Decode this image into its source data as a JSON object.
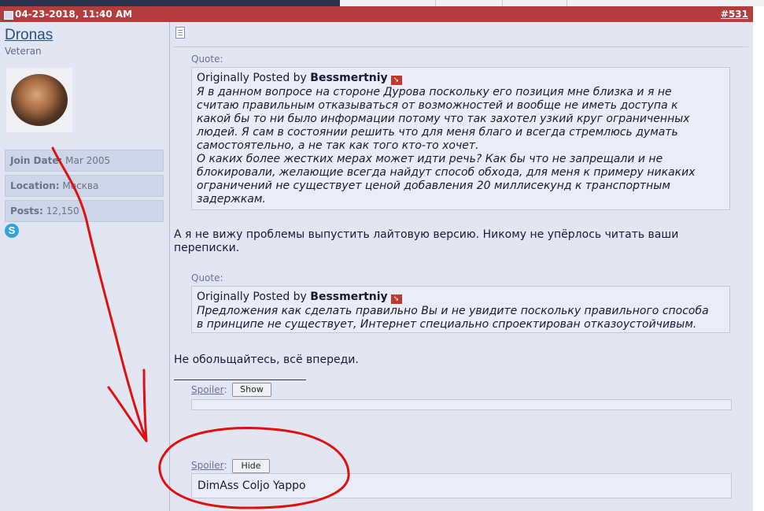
{
  "post": {
    "date": "04-23-2018, 11:40 AM",
    "number": "#531"
  },
  "user": {
    "name": "Dronas",
    "title": "Veteran",
    "join_label": "Join Date:",
    "join_value": "Mar 2005",
    "location_label": "Location:",
    "location_value": "Москва",
    "posts_label": "Posts:",
    "posts_value": "12,150",
    "skype_glyph": "S"
  },
  "quotes": [
    {
      "label": "Quote:",
      "prefix": "Originally Posted by",
      "author": "Bessmertniy",
      "lines": [
        "Я в данном вопросе на стороне Дурова поскольку его позиция мне близка и я не",
        "считаю правильным отказываться от возможностей и вообще не иметь доступа к",
        "какой бы то ни было информации потому что так захотел узкий круг ограниченных",
        "людей. Я сам в состоянии решить что для меня благо и всегда стремлюсь думать",
        "самостоятельно, а не так как того кто-то хочет.",
        "О каких более жестких мерах может идти речь? Как бы что не запрещали и не",
        "блокировали, желающие всегда найдут способ обхода, для меня к примеру никаких",
        "ограничений не существует ценой добавления 20 миллисекунд к транспортным",
        "задержкам."
      ]
    },
    {
      "label": "Quote:",
      "prefix": "Originally Posted by",
      "author": "Bessmertniy",
      "lines": [
        "Предложения как сделать правильно Вы и не увидите поскольку правильного способа",
        "в принципе не существует, Интернет специально спроектирован отказоустойчивым."
      ]
    }
  ],
  "reply_lines": [
    "А я не вижу проблемы выпустить лайтовую версию. Никому не упёрлось читать ваши",
    "переписки."
  ],
  "reply2": "Не обольщайтесь, всё впереди.",
  "spoilers": [
    {
      "label": "Spoiler",
      "colon": ":",
      "button": "Show",
      "content": ""
    },
    {
      "label": "Spoiler",
      "colon": ":",
      "button": "Hide",
      "content": "DimAss Coljo Yappo"
    }
  ],
  "colors": {
    "header": "#b33c3c",
    "pane": "#e2e6f2",
    "annotation": "#e01010"
  }
}
